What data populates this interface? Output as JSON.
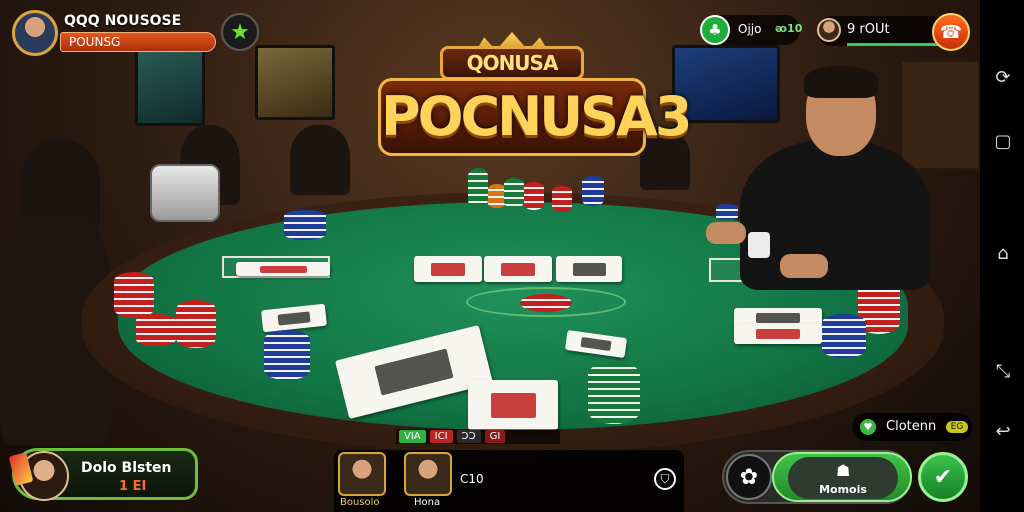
{
  "logo": {
    "top_text": "QONUSA",
    "main_text": "POCNUSA3"
  },
  "top_left_player": {
    "name": "QQQ NOUSOSE",
    "subtitle": "POUNSG",
    "avatar_icon": "player-avatar-icon"
  },
  "top_left_button": {
    "icon": "star-icon",
    "glyph": "★"
  },
  "top_right_coins": {
    "icon_glyph": "♣",
    "label": "Ojjo",
    "value": "ᴔ10"
  },
  "top_right_player": {
    "name": "9 rOUt",
    "avatar_icon": "player-avatar-icon"
  },
  "top_right_button": {
    "icon": "phone-icon",
    "glyph": "☎"
  },
  "table_strip": {
    "items": [
      "VIA",
      "ICI",
      "ƆƆ",
      "GI"
    ],
    "colors": [
      "#2fb33f",
      "#b5261f",
      "#2a2a2a",
      "#8a1a1a"
    ]
  },
  "bottom_left_player": {
    "name": "Dolo Blsten",
    "amount": "1 EI"
  },
  "bottom_center": {
    "players": [
      {
        "label": "Bousolo",
        "avatar_icon": "player-avatar-icon"
      },
      {
        "label": "Hona",
        "avatar_icon": "player-avatar-icon"
      }
    ],
    "value": "C10",
    "info_icon": "shield-icon"
  },
  "bottom_right_tag": {
    "icon_glyph": "♥",
    "label": "Clotenn",
    "value": "EG"
  },
  "actions": {
    "left_icon": "gear-icon",
    "left_glyph": "✿",
    "middle_icon": "robot-icon",
    "middle_glyph": "☗",
    "middle_label": "Momois",
    "right_icon": "check-icon",
    "right_glyph": "✔"
  },
  "nav": {
    "items": [
      {
        "icon": "rotate-icon",
        "glyph": "⟳"
      },
      {
        "icon": "square-icon",
        "glyph": "▢"
      },
      {
        "icon": "home-icon",
        "glyph": "⌂"
      },
      {
        "icon": "resize-icon",
        "glyph": "⤡"
      },
      {
        "icon": "back-icon",
        "glyph": "↩"
      }
    ]
  }
}
